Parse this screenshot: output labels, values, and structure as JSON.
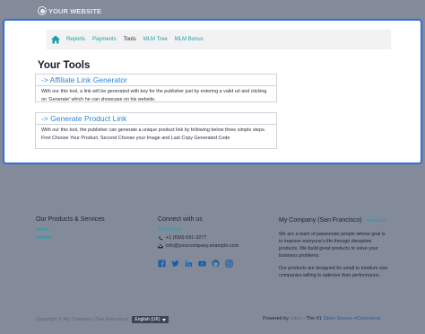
{
  "header": {
    "logo_text": "YOUR WEBSITE",
    "logo_icon": "wordpress-icon"
  },
  "breadcrumb": {
    "home_icon": "home-icon",
    "items": [
      {
        "label": "Reports",
        "active": false
      },
      {
        "label": "Payments",
        "active": false
      },
      {
        "label": "Tools",
        "active": true
      },
      {
        "label": "MLM Tree",
        "active": false
      },
      {
        "label": "MLM Bonus",
        "active": false
      }
    ]
  },
  "main": {
    "title": "Your Tools",
    "tools": [
      {
        "link": "-> Affiliate Link Generator",
        "description": "With our this tool, a link will be generated with key for the publisher just by entering a valid url and clicking on 'Generate' which he can showcase on his website."
      },
      {
        "link": "-> Generate Product Link",
        "description": "With our this tool, the publisher can generate a unique product link by following below three simple steps. First Choose Your Product, Second Choose your Image and Last Copy Generated Code"
      }
    ]
  },
  "footer": {
    "products": {
      "heading": "Our Products & Services",
      "links": [
        "Home",
        "Affiliate"
      ]
    },
    "connect": {
      "heading": "Connect with us",
      "contact_link": "Contact us",
      "phone": "+1 (650) 691-3277",
      "email": "info@yourcompany.example.com",
      "socials": [
        "facebook-icon",
        "twitter-icon",
        "linkedin-icon",
        "youtube-icon",
        "github-icon",
        "instagram-icon"
      ]
    },
    "company": {
      "heading": "My Company (San Francisco)",
      "about_link": "- About us",
      "paragraph1": "We are a team of passionate people whose goal is to improve everyone's life through disruptive products. We build great products to solve your business problems.",
      "paragraph2": "Our products are designed for small to medium size companies willing to optimize their performance."
    },
    "copyright": "Copyright © My Company (San Francisco)",
    "language": "English (UK)",
    "powered_by": "Powered by",
    "odoo": "odoo",
    "powered_middle": "- The #1",
    "powered_link": "Open Source eCommerce"
  },
  "colors": {
    "accent_teal": "#1aa0a8",
    "link_blue": "#2f86d6",
    "card_border": "#2f6fe0",
    "overlay": "#838a99"
  }
}
